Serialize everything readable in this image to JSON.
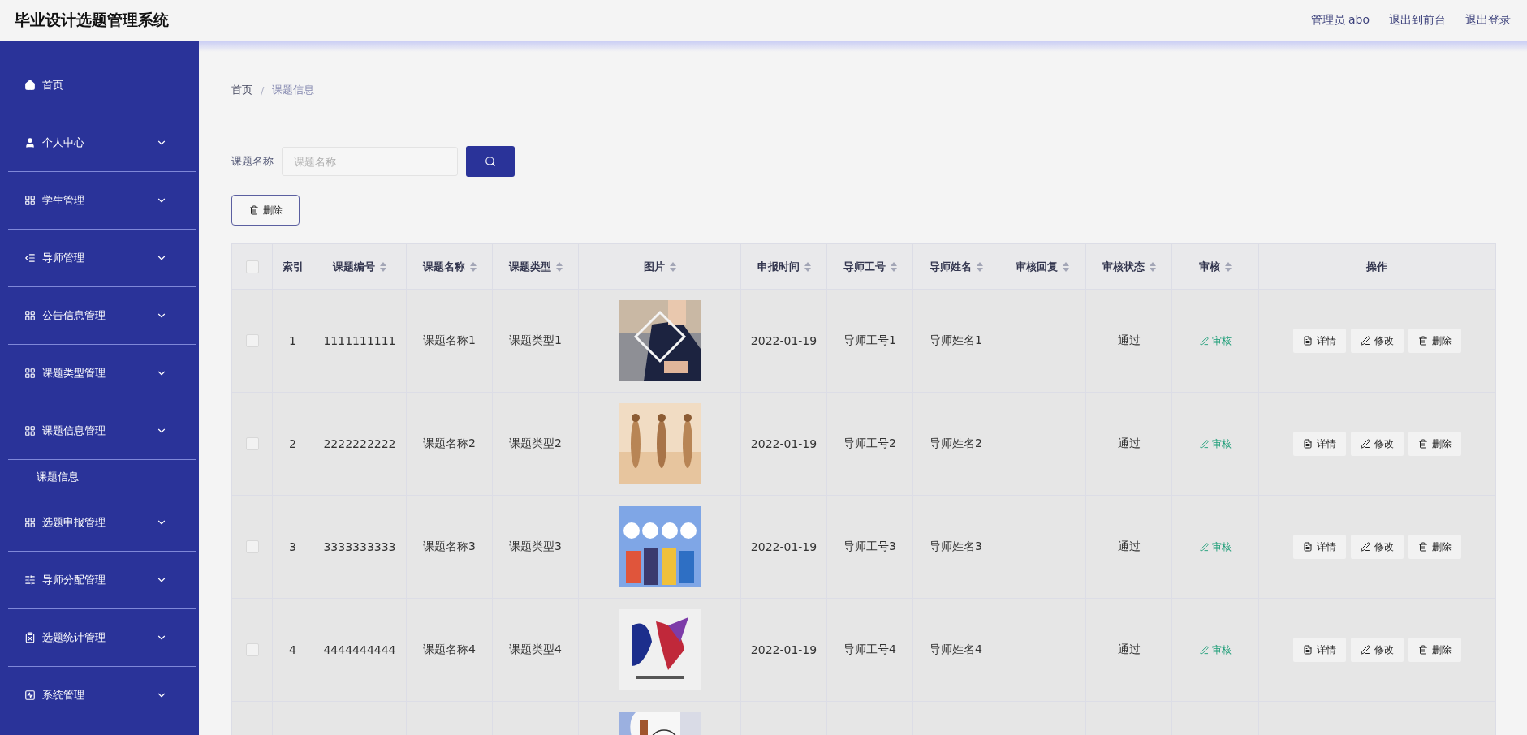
{
  "header": {
    "title": "毕业设计选题管理系统",
    "links": [
      "管理员 abo",
      "退出到前台",
      "退出登录"
    ]
  },
  "sidebar": {
    "items": [
      {
        "label": "首页"
      },
      {
        "label": "个人中心"
      },
      {
        "label": "学生管理"
      },
      {
        "label": "导师管理"
      },
      {
        "label": "公告信息管理"
      },
      {
        "label": "课题类型管理"
      },
      {
        "label": "课题信息管理",
        "children": [
          {
            "label": "课题信息"
          }
        ]
      },
      {
        "label": "选题申报管理"
      },
      {
        "label": "导师分配管理"
      },
      {
        "label": "选题统计管理"
      },
      {
        "label": "系统管理"
      }
    ]
  },
  "breadcrumb": {
    "items": [
      "首页",
      "课题信息"
    ],
    "separator": "/"
  },
  "search": {
    "label": "课题名称",
    "placeholder": "课题名称"
  },
  "delete_button": "删除",
  "table": {
    "all_checked": false,
    "columns": [
      {
        "label": "索引",
        "sortable": false
      },
      {
        "label": "课题编号",
        "sortable": true
      },
      {
        "label": "课题名称",
        "sortable": true
      },
      {
        "label": "课题类型",
        "sortable": true
      },
      {
        "label": "图片",
        "sortable": true
      },
      {
        "label": "申报时间",
        "sortable": true
      },
      {
        "label": "导师工号",
        "sortable": true
      },
      {
        "label": "导师姓名",
        "sortable": true
      },
      {
        "label": "审核回复",
        "sortable": true
      },
      {
        "label": "审核状态",
        "sortable": true
      },
      {
        "label": "审核",
        "sortable": true
      },
      {
        "label": "操作",
        "sortable": false
      }
    ],
    "rows": [
      {
        "checked": false,
        "index": "1",
        "code": "1111111111",
        "name": "课题名称1",
        "type": "课题类型1",
        "image": {
          "kind": "picture"
        },
        "date": "2022-01-19",
        "tutor_id": "导师工号1",
        "tutor_name": "导师姓名1",
        "status": "通过",
        "review": "审核",
        "actions": [
          "详情",
          "修改",
          "删除"
        ]
      },
      {
        "checked": false,
        "index": "2",
        "code": "2222222222",
        "name": "课题名称2",
        "type": "课题类型2",
        "image": {
          "kind": "picture"
        },
        "date": "2022-01-19",
        "tutor_id": "导师工号2",
        "tutor_name": "导师姓名2",
        "status": "通过",
        "review": "审核",
        "actions": [
          "详情",
          "修改",
          "删除"
        ]
      },
      {
        "checked": false,
        "index": "3",
        "code": "3333333333",
        "name": "课题名称3",
        "type": "课题类型3",
        "image": {
          "kind": "picture"
        },
        "date": "2022-01-19",
        "tutor_id": "导师工号3",
        "tutor_name": "导师姓名3",
        "status": "通过",
        "review": "审核",
        "actions": [
          "详情",
          "修改",
          "删除"
        ]
      },
      {
        "checked": false,
        "index": "4",
        "code": "4444444444",
        "name": "课题名称4",
        "type": "课题类型4",
        "image": {
          "kind": "picture"
        },
        "date": "2022-01-19",
        "tutor_id": "导师工号4",
        "tutor_name": "导师姓名4",
        "status": "通过",
        "review": "审核",
        "actions": [
          "详情",
          "修改",
          "删除"
        ]
      },
      {
        "image": {
          "kind": "picture"
        }
      }
    ]
  }
}
